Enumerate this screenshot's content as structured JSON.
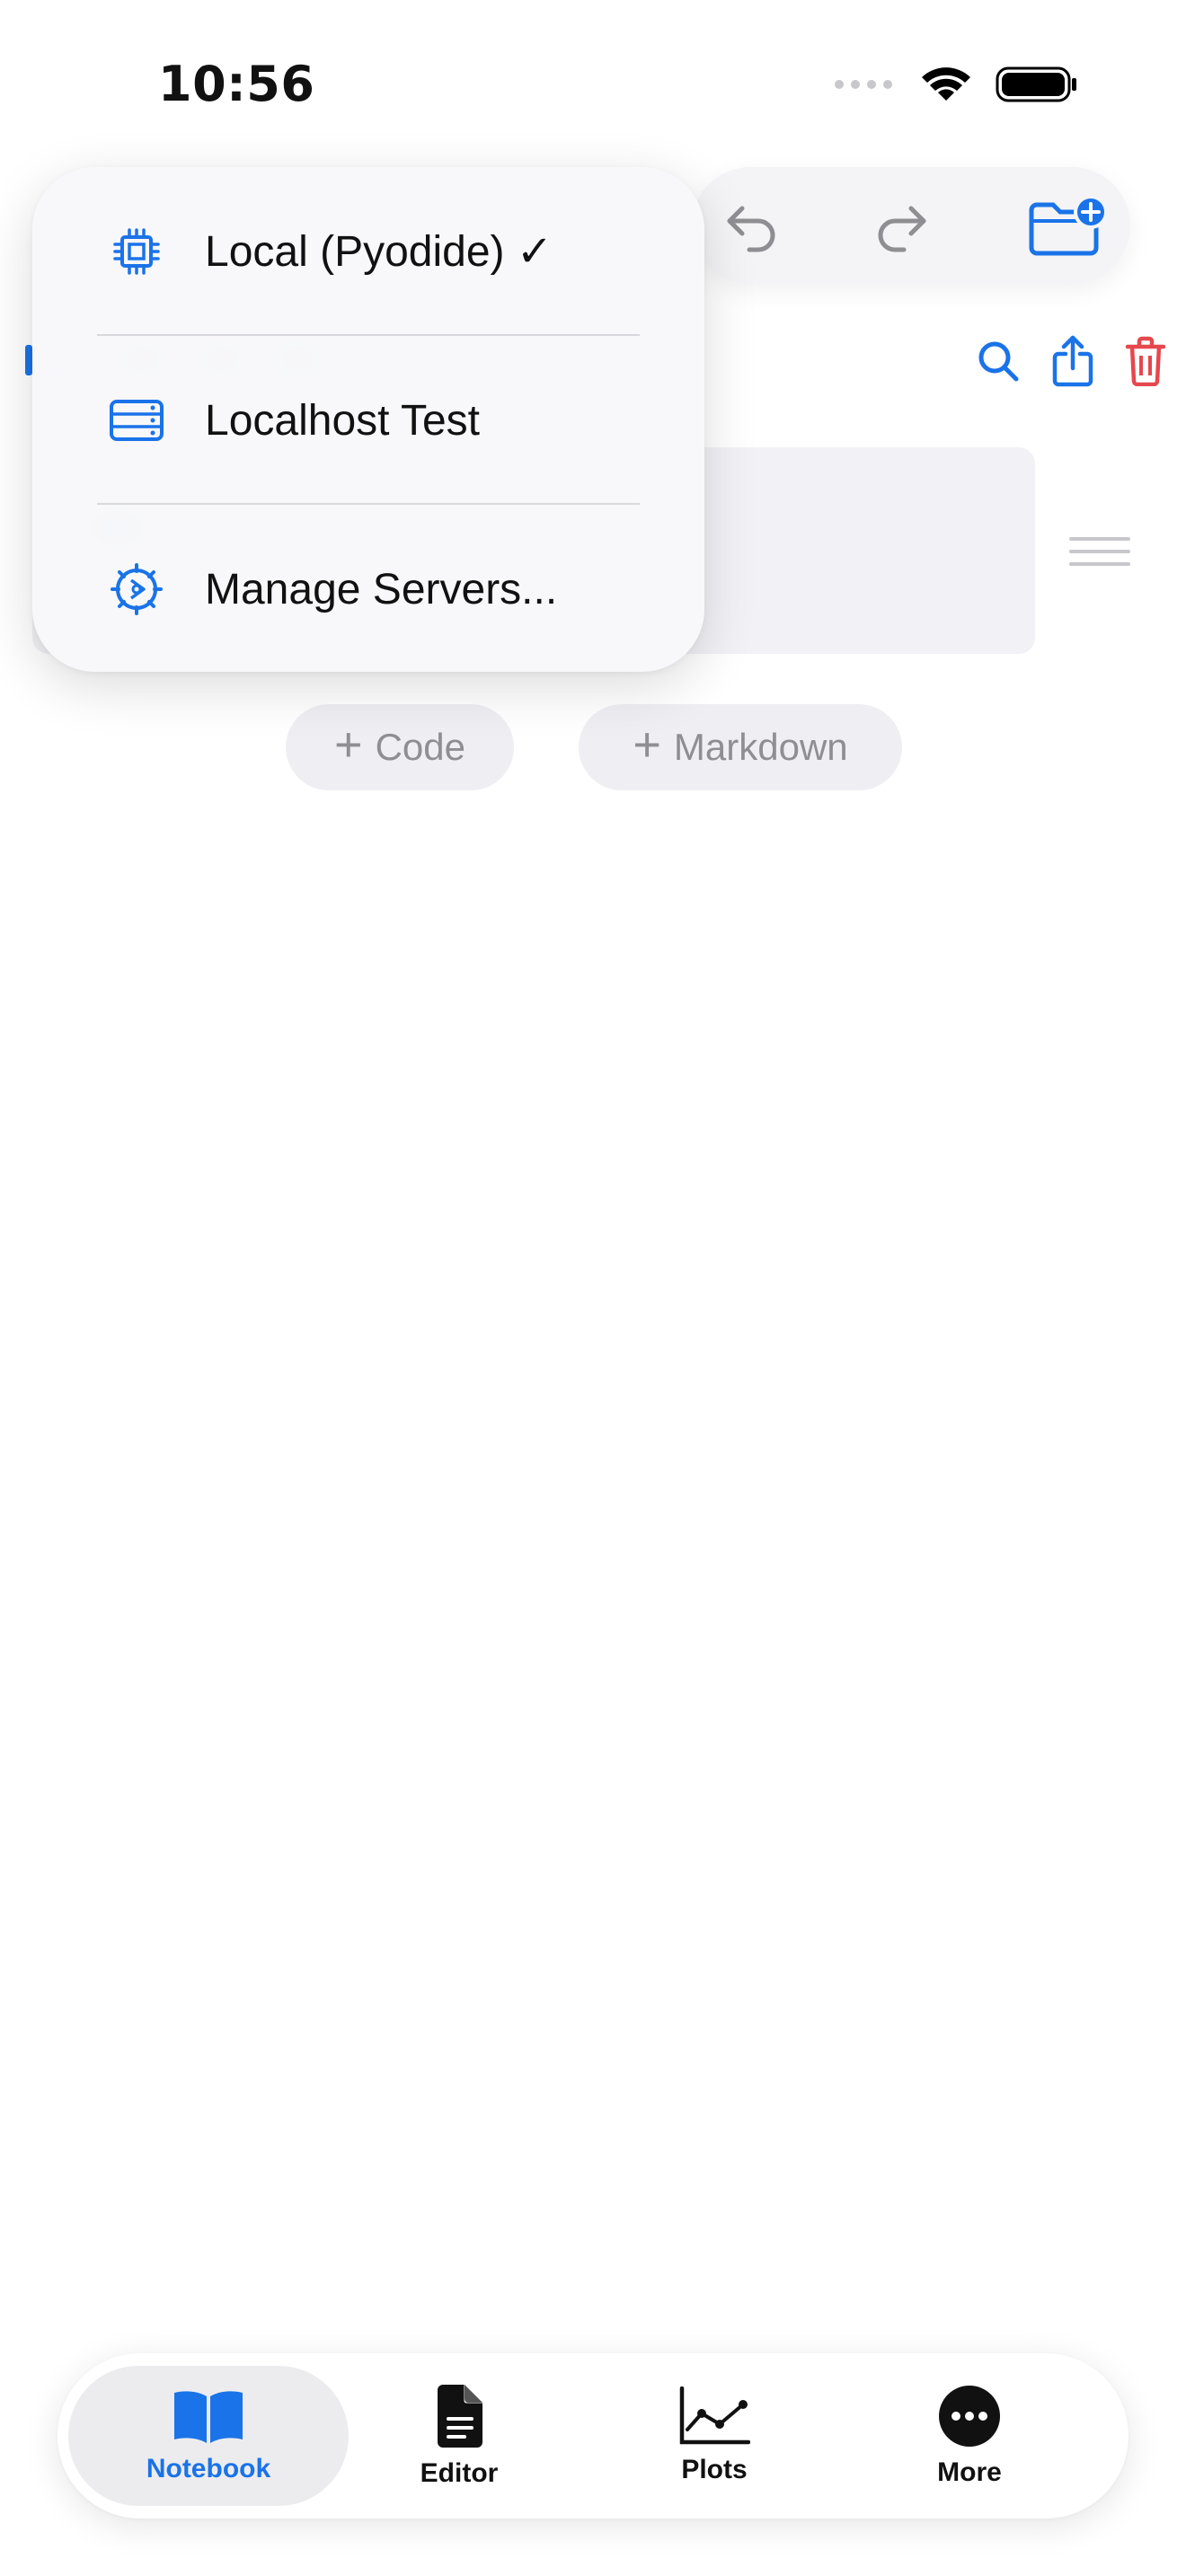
{
  "status": {
    "time": "10:56"
  },
  "toolbar": {
    "undo_icon": "undo-arrow-icon",
    "redo_icon": "redo-arrow-icon",
    "new_folder_icon": "folder-plus-icon"
  },
  "cell_actions": {
    "search_icon": "magnifier-icon",
    "share_icon": "share-icon",
    "delete_icon": "trash-icon"
  },
  "add_buttons": {
    "code": "Code",
    "markdown": "Markdown"
  },
  "kernel_menu": {
    "items": [
      {
        "label": "Local (Pyodide) ✓",
        "icon": "chip-icon"
      },
      {
        "label": "Localhost Test",
        "icon": "server-rack-icon"
      },
      {
        "label": "Manage Servers...",
        "icon": "gear-icon"
      }
    ]
  },
  "tabbar": {
    "tabs": [
      {
        "label": "Notebook",
        "icon": "book-icon",
        "active": true
      },
      {
        "label": "Editor",
        "icon": "document-icon",
        "active": false
      },
      {
        "label": "Plots",
        "icon": "line-chart-icon",
        "active": false
      },
      {
        "label": "More",
        "icon": "ellipsis-circle-icon",
        "active": false
      }
    ]
  },
  "colors": {
    "accent": "#1A73E8",
    "destructive": "#E5484D",
    "muted": "#8E8E93"
  }
}
